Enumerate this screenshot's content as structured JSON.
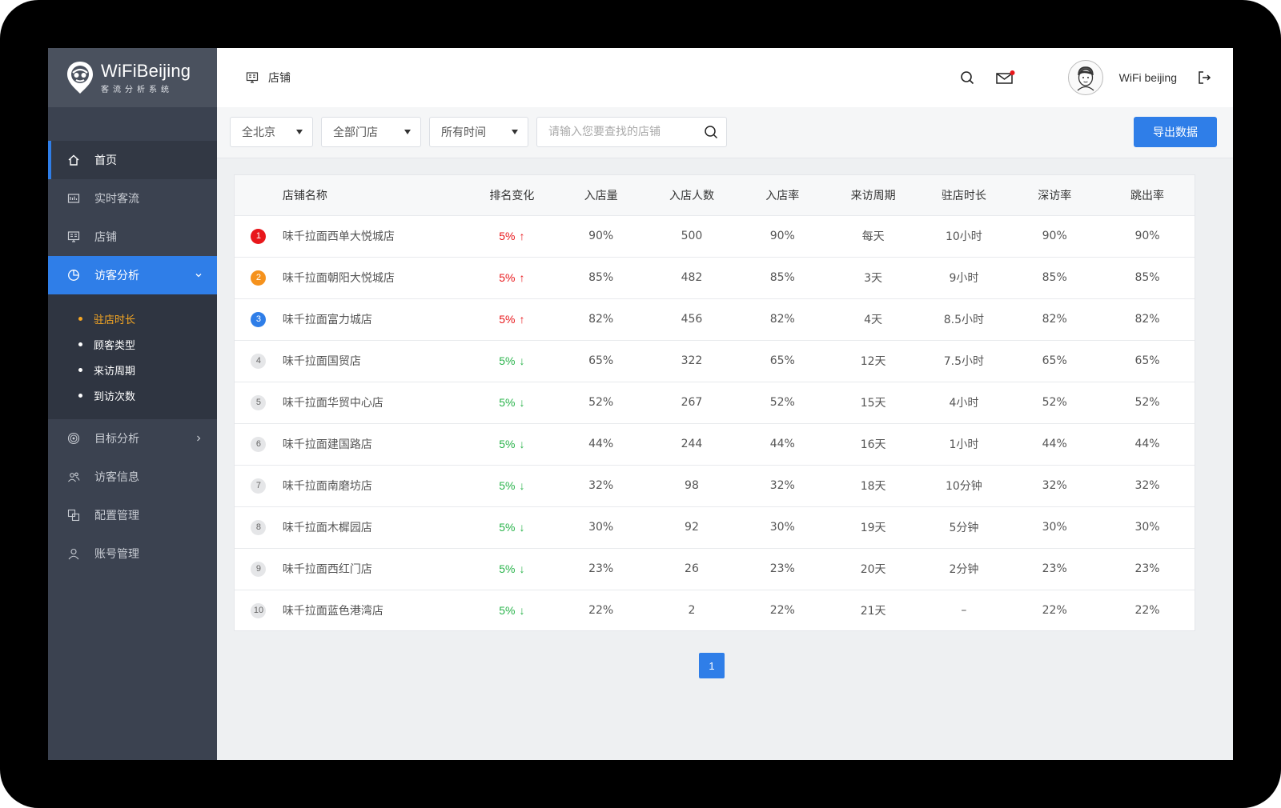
{
  "app": {
    "title": "WiFiBeijing",
    "subtitle": "客流分析系统"
  },
  "sidebar": {
    "items": [
      {
        "label": "首页",
        "icon": "home-icon"
      },
      {
        "label": "实时客流",
        "icon": "monitor-icon"
      },
      {
        "label": "店铺",
        "icon": "store-icon"
      },
      {
        "label": "访客分析",
        "icon": "pie-chart-icon"
      },
      {
        "label": "目标分析",
        "icon": "target-icon"
      },
      {
        "label": "访客信息",
        "icon": "users-icon"
      },
      {
        "label": "配置管理",
        "icon": "config-icon"
      },
      {
        "label": "账号管理",
        "icon": "user-icon"
      }
    ],
    "submenu": [
      "驻店时长",
      "顾客类型",
      "来访周期",
      "到访次数"
    ]
  },
  "header": {
    "breadcrumb": "店铺",
    "user_name": "WiFi beijing"
  },
  "toolbar": {
    "region_select": "全北京",
    "store_select": "全部门店",
    "time_select": "所有时间",
    "search_placeholder": "请输入您要查找的店铺",
    "export_label": "导出数据"
  },
  "table": {
    "columns": [
      "店铺名称",
      "排名变化",
      "入店量",
      "入店人数",
      "入店率",
      "来访周期",
      "驻店时长",
      "深访率",
      "跳出率"
    ],
    "rows": [
      {
        "rank": "1",
        "name": "味千拉面西单大悦城店",
        "change": "5%",
        "dir": "up",
        "arrow": "↑",
        "entry": "90%",
        "people": "500",
        "rate": "90%",
        "cycle": "每天",
        "stay": "10小时",
        "deep": "90%",
        "bounce": "90%"
      },
      {
        "rank": "2",
        "name": "味千拉面朝阳大悦城店",
        "change": "5%",
        "dir": "up",
        "arrow": "↑",
        "entry": "85%",
        "people": "482",
        "rate": "85%",
        "cycle": "3天",
        "stay": "9小时",
        "deep": "85%",
        "bounce": "85%"
      },
      {
        "rank": "3",
        "name": "味千拉面富力城店",
        "change": "5%",
        "dir": "up",
        "arrow": "↑",
        "entry": "82%",
        "people": "456",
        "rate": "82%",
        "cycle": "4天",
        "stay": "8.5小时",
        "deep": "82%",
        "bounce": "82%"
      },
      {
        "rank": "4",
        "name": "味千拉面国贸店",
        "change": "5%",
        "dir": "down",
        "arrow": "↓",
        "entry": "65%",
        "people": "322",
        "rate": "65%",
        "cycle": "12天",
        "stay": "7.5小时",
        "deep": "65%",
        "bounce": "65%"
      },
      {
        "rank": "5",
        "name": "味千拉面华贸中心店",
        "change": "5%",
        "dir": "down",
        "arrow": "↓",
        "entry": "52%",
        "people": "267",
        "rate": "52%",
        "cycle": "15天",
        "stay": "4小时",
        "deep": "52%",
        "bounce": "52%"
      },
      {
        "rank": "6",
        "name": "味千拉面建国路店",
        "change": "5%",
        "dir": "down",
        "arrow": "↓",
        "entry": "44%",
        "people": "244",
        "rate": "44%",
        "cycle": "16天",
        "stay": "1小时",
        "deep": "44%",
        "bounce": "44%"
      },
      {
        "rank": "7",
        "name": "味千拉面南磨坊店",
        "change": "5%",
        "dir": "down",
        "arrow": "↓",
        "entry": "32%",
        "people": "98",
        "rate": "32%",
        "cycle": "18天",
        "stay": "10分钟",
        "deep": "32%",
        "bounce": "32%"
      },
      {
        "rank": "8",
        "name": "味千拉面木樨园店",
        "change": "5%",
        "dir": "down",
        "arrow": "↓",
        "entry": "30%",
        "people": "92",
        "rate": "30%",
        "cycle": "19天",
        "stay": "5分钟",
        "deep": "30%",
        "bounce": "30%"
      },
      {
        "rank": "9",
        "name": "味千拉面西红门店",
        "change": "5%",
        "dir": "down",
        "arrow": "↓",
        "entry": "23%",
        "people": "26",
        "rate": "23%",
        "cycle": "20天",
        "stay": "2分钟",
        "deep": "23%",
        "bounce": "23%"
      },
      {
        "rank": "10",
        "name": "味千拉面蓝色港湾店",
        "change": "5%",
        "dir": "down",
        "arrow": "↓",
        "entry": "22%",
        "people": "2",
        "rate": "22%",
        "cycle": "21天",
        "stay": "–",
        "deep": "22%",
        "bounce": "22%"
      }
    ]
  },
  "pagination": {
    "current": "1"
  },
  "colors": {
    "accent": "#2f7ee8",
    "sidebar_bg": "#3b4250",
    "up": "#e8171b",
    "down": "#28b34a",
    "submenu_active": "#f5a623"
  }
}
